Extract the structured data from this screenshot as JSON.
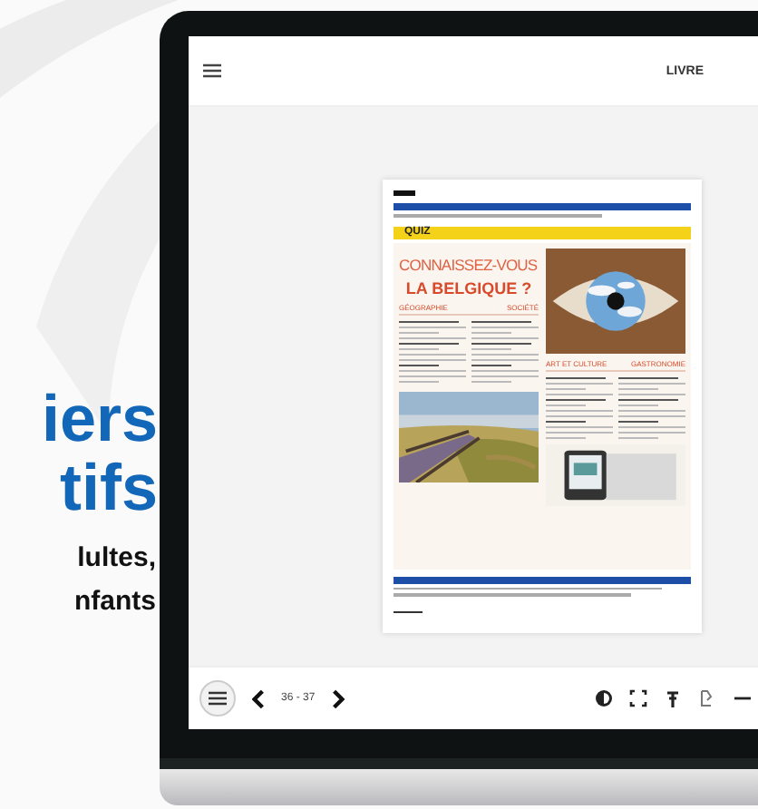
{
  "promo": {
    "headline": [
      "iers",
      "tifs"
    ],
    "subline": [
      "lultes,",
      "nfants"
    ]
  },
  "reader": {
    "top_bar": {
      "title": "LIVRE"
    },
    "document": {
      "section": "QUIZ",
      "title": "CONNAISSEZ-VOUS",
      "subtitle": "LA BELGIQUE ?",
      "categories": [
        "GÉOGRAPHIE",
        "SOCIÉTÉ",
        "ART ET CULTURE",
        "GASTRONOMIE"
      ]
    },
    "bottom_bar": {
      "pages": "36 - 37"
    }
  }
}
